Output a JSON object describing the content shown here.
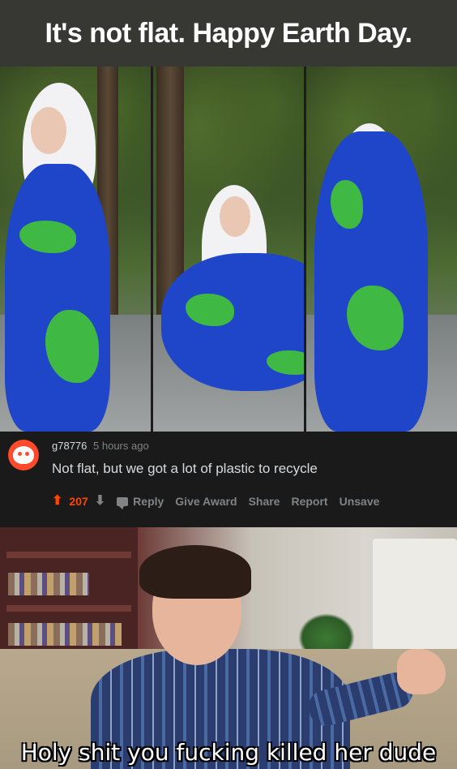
{
  "top_caption": "It's not flat. Happy Earth Day.",
  "comment": {
    "username": "g78776",
    "time": "5 hours ago",
    "text": "Not flat, but we got a lot of plastic to recycle",
    "score": "207",
    "actions": {
      "reply": "Reply",
      "give_award": "Give Award",
      "share": "Share",
      "report": "Report",
      "unsave": "Unsave"
    },
    "upvote_icon": "upvote-arrow-icon",
    "downvote_icon": "downvote-arrow-icon",
    "reply_icon": "comment-bubble-icon",
    "colors": {
      "score": "#ff4500",
      "avatar": "#ff4a2b",
      "background": "#1a1a1b"
    }
  },
  "bottom_caption": "Holy shit you fucking killed her dude"
}
